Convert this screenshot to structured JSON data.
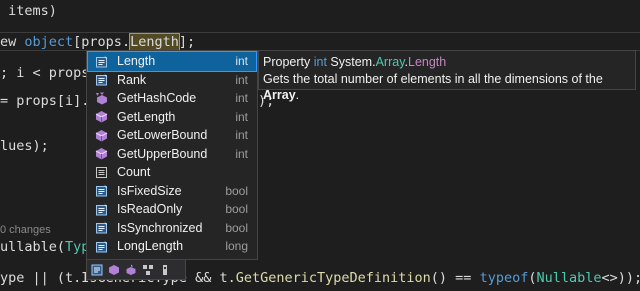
{
  "editor": {
    "line1": {
      "text": " items)"
    },
    "line2": {
      "prefix": "ew ",
      "kw_object": "object",
      "mid": "[props.",
      "highlight": "Length",
      "suffix": "];"
    },
    "line3": {
      "text": "; i < props."
    },
    "line4": {
      "text": "= props[i].G",
      "suffix": ");"
    },
    "line5": {
      "text": "lues);"
    },
    "codelens": "0 changes",
    "line6": {
      "prefix": "ullable(",
      "typ": "Type"
    },
    "line7": {
      "prefix": "ype || (t.IsGener",
      "mid": "icTyp",
      "part": "e && t.",
      "fn": "GetGenericTypeDefinition",
      "mid2": "() == ",
      "kw_typeof": "typeof",
      "open": "(",
      "typ": "Nullable",
      "end": "<>));"
    }
  },
  "intellisense": {
    "items": [
      {
        "label": "Length",
        "type": "int",
        "icon": "property-icon",
        "selected": true
      },
      {
        "label": "Rank",
        "type": "int",
        "icon": "property-icon",
        "selected": false
      },
      {
        "label": "GetHashCode",
        "type": "int",
        "icon": "virtual-method-icon",
        "selected": false
      },
      {
        "label": "GetLength",
        "type": "int",
        "icon": "method-icon",
        "selected": false
      },
      {
        "label": "GetLowerBound",
        "type": "int",
        "icon": "method-icon",
        "selected": false
      },
      {
        "label": "GetUpperBound",
        "type": "int",
        "icon": "method-icon",
        "selected": false
      },
      {
        "label": "Count",
        "type": "",
        "icon": "extension-property-icon",
        "selected": false
      },
      {
        "label": "IsFixedSize",
        "type": "bool",
        "icon": "property-icon",
        "selected": false
      },
      {
        "label": "IsReadOnly",
        "type": "bool",
        "icon": "property-icon",
        "selected": false
      },
      {
        "label": "IsSynchronized",
        "type": "bool",
        "icon": "property-icon",
        "selected": false
      },
      {
        "label": "LongLength",
        "type": "long",
        "icon": "property-icon",
        "selected": false
      }
    ],
    "filters": [
      "properties-filter-icon",
      "methods-filter-icon",
      "extension-methods-filter-icon",
      "namespaces-filter-icon",
      "keywords-filter-icon"
    ]
  },
  "tooltip": {
    "kind": "Property",
    "type_kw": "int",
    "ns": "System.",
    "typename": "Array",
    "dot": ".",
    "member": "Length",
    "desc_prefix": "Gets the total number of elements in all the dimensions of the",
    "desc_type": "Array",
    "desc_suffix": "."
  },
  "colors": {
    "editor_bg": "#1e1e1e",
    "selection": "#0e639c",
    "keyword": "#569cd6",
    "type": "#4ec9b0",
    "method": "#dcdcaa",
    "member": "#c586c0"
  }
}
